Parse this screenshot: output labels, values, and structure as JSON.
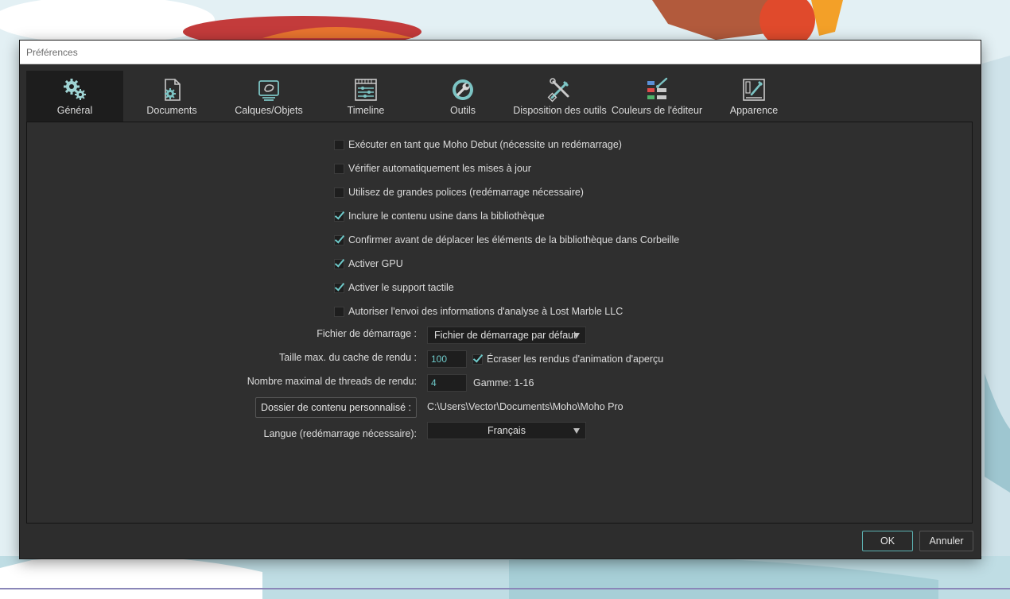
{
  "window": {
    "title": "Préférences"
  },
  "tabs": [
    {
      "label": "Général",
      "icon": "gears-icon",
      "active": true
    },
    {
      "label": "Documents",
      "icon": "document-gear-icon"
    },
    {
      "label": "Calques/Objets",
      "icon": "layers-objects-icon"
    },
    {
      "label": "Timeline",
      "icon": "timeline-icon"
    },
    {
      "label": "Outils",
      "icon": "tools-wrench-icon"
    },
    {
      "label": "Disposition des outils",
      "icon": "tool-layout-icon"
    },
    {
      "label": "Couleurs de l'éditeur",
      "icon": "editor-colors-icon"
    },
    {
      "label": "Apparence",
      "icon": "appearance-icon"
    }
  ],
  "options": [
    {
      "label": "Exécuter en tant que Moho Debut (nécessite un redémarrage)",
      "checked": false
    },
    {
      "label": "Vérifier automatiquement les mises à jour",
      "checked": false
    },
    {
      "label": "Utilisez de grandes polices (redémarrage nécessaire)",
      "checked": false
    },
    {
      "label": "Inclure le contenu usine dans la bibliothèque",
      "checked": true
    },
    {
      "label": "Confirmer avant de déplacer les éléments de la bibliothèque dans Corbeille",
      "checked": true
    },
    {
      "label": "Activer GPU",
      "checked": true
    },
    {
      "label": "Activer le support tactile",
      "checked": true
    },
    {
      "label": "Autoriser l'envoi des informations d'analyse à Lost Marble LLC",
      "checked": false
    }
  ],
  "startup_file": {
    "label": "Fichier de démarrage :",
    "value": "Fichier de démarrage par défaut"
  },
  "render_cache": {
    "label": "Taille max. du cache de rendu :",
    "value": "100",
    "overwrite_label": "Écraser les rendus d'animation d'aperçu",
    "overwrite_checked": true
  },
  "render_threads": {
    "label": "Nombre maximal de threads de rendu:",
    "value": "4",
    "range_label": "Gamme: 1-16"
  },
  "content_folder": {
    "button_label": "Dossier de contenu personnalisé :",
    "path": "C:\\Users\\Vector\\Documents\\Moho\\Moho Pro"
  },
  "language": {
    "label": "Langue (redémarrage nécessaire):",
    "value": "Français"
  },
  "buttons": {
    "ok": "OK",
    "cancel": "Annuler"
  },
  "colors": {
    "accent": "#6ec9c9",
    "panel": "#2d2d2d",
    "field": "#1e1e1e"
  }
}
